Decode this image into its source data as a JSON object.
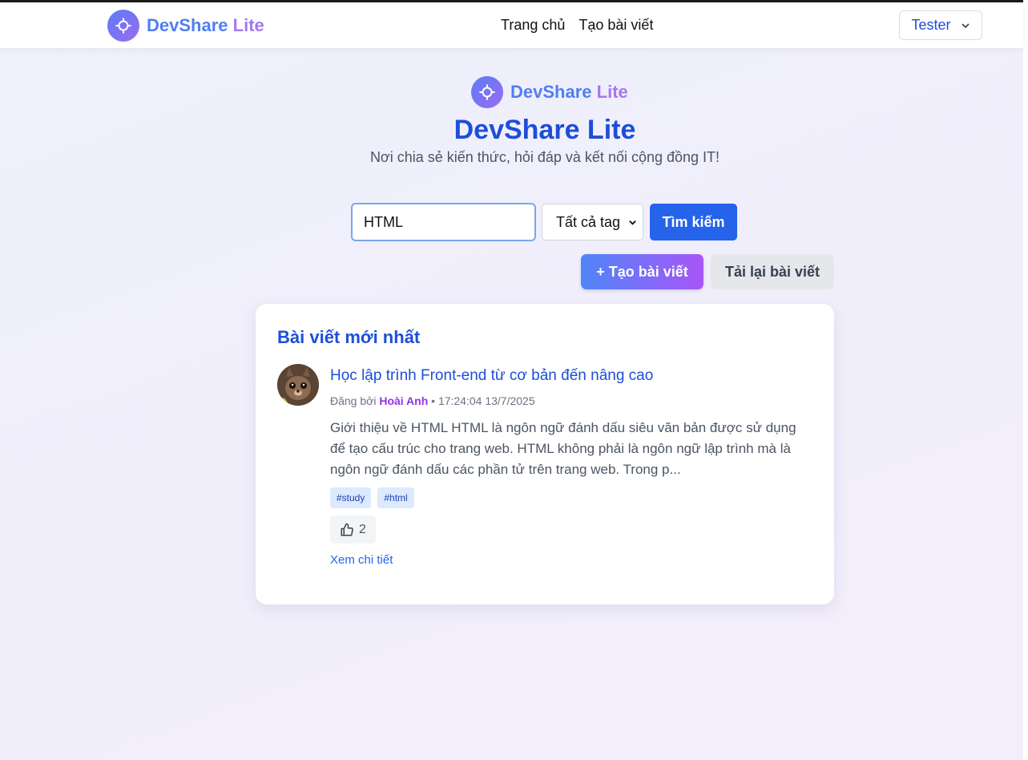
{
  "navbar": {
    "brand_part1": "DevShare",
    "brand_part2": "Lite",
    "links": [
      "Trang chủ",
      "Tạo bài viết"
    ],
    "user_label": "Tester"
  },
  "hero": {
    "brand_part1": "DevShare",
    "brand_part2": "Lite",
    "title": "DevShare Lite",
    "subtitle": "Nơi chia sẻ kiến thức, hỏi đáp và kết nối cộng đồng IT!"
  },
  "search": {
    "value": "HTML",
    "tag_select_value": "Tất cả tag",
    "submit_label": "Tìm kiếm"
  },
  "actions": {
    "create_label": "+ Tạo bài viết",
    "reload_label": "Tải lại bài viết"
  },
  "latest": {
    "heading": "Bài viết mới nhất",
    "posts": [
      {
        "title": "Học lập trình Front-end từ cơ bản đến nâng cao",
        "posted_by_label": "Đăng bởi",
        "author": "Hoài Anh",
        "separator": "•",
        "timestamp": "17:24:04 13/7/2025",
        "excerpt": "Giới thiệu về HTML HTML là ngôn ngữ đánh dấu siêu văn bản được sử dụng để tạo cấu trúc cho trang web. HTML không phải là ngôn ngữ lập trình mà là ngôn ngữ đánh dấu các phần tử trên trang web. Trong p...",
        "tags": [
          "#study",
          "#html"
        ],
        "likes": "2",
        "detail_label": "Xem chi tiết"
      }
    ]
  },
  "colors": {
    "primary": "#1d4ed8",
    "button_blue": "#2563eb",
    "author_purple": "#9333ea",
    "gradient_start": "#4f86f7",
    "gradient_end": "#a855f7"
  }
}
